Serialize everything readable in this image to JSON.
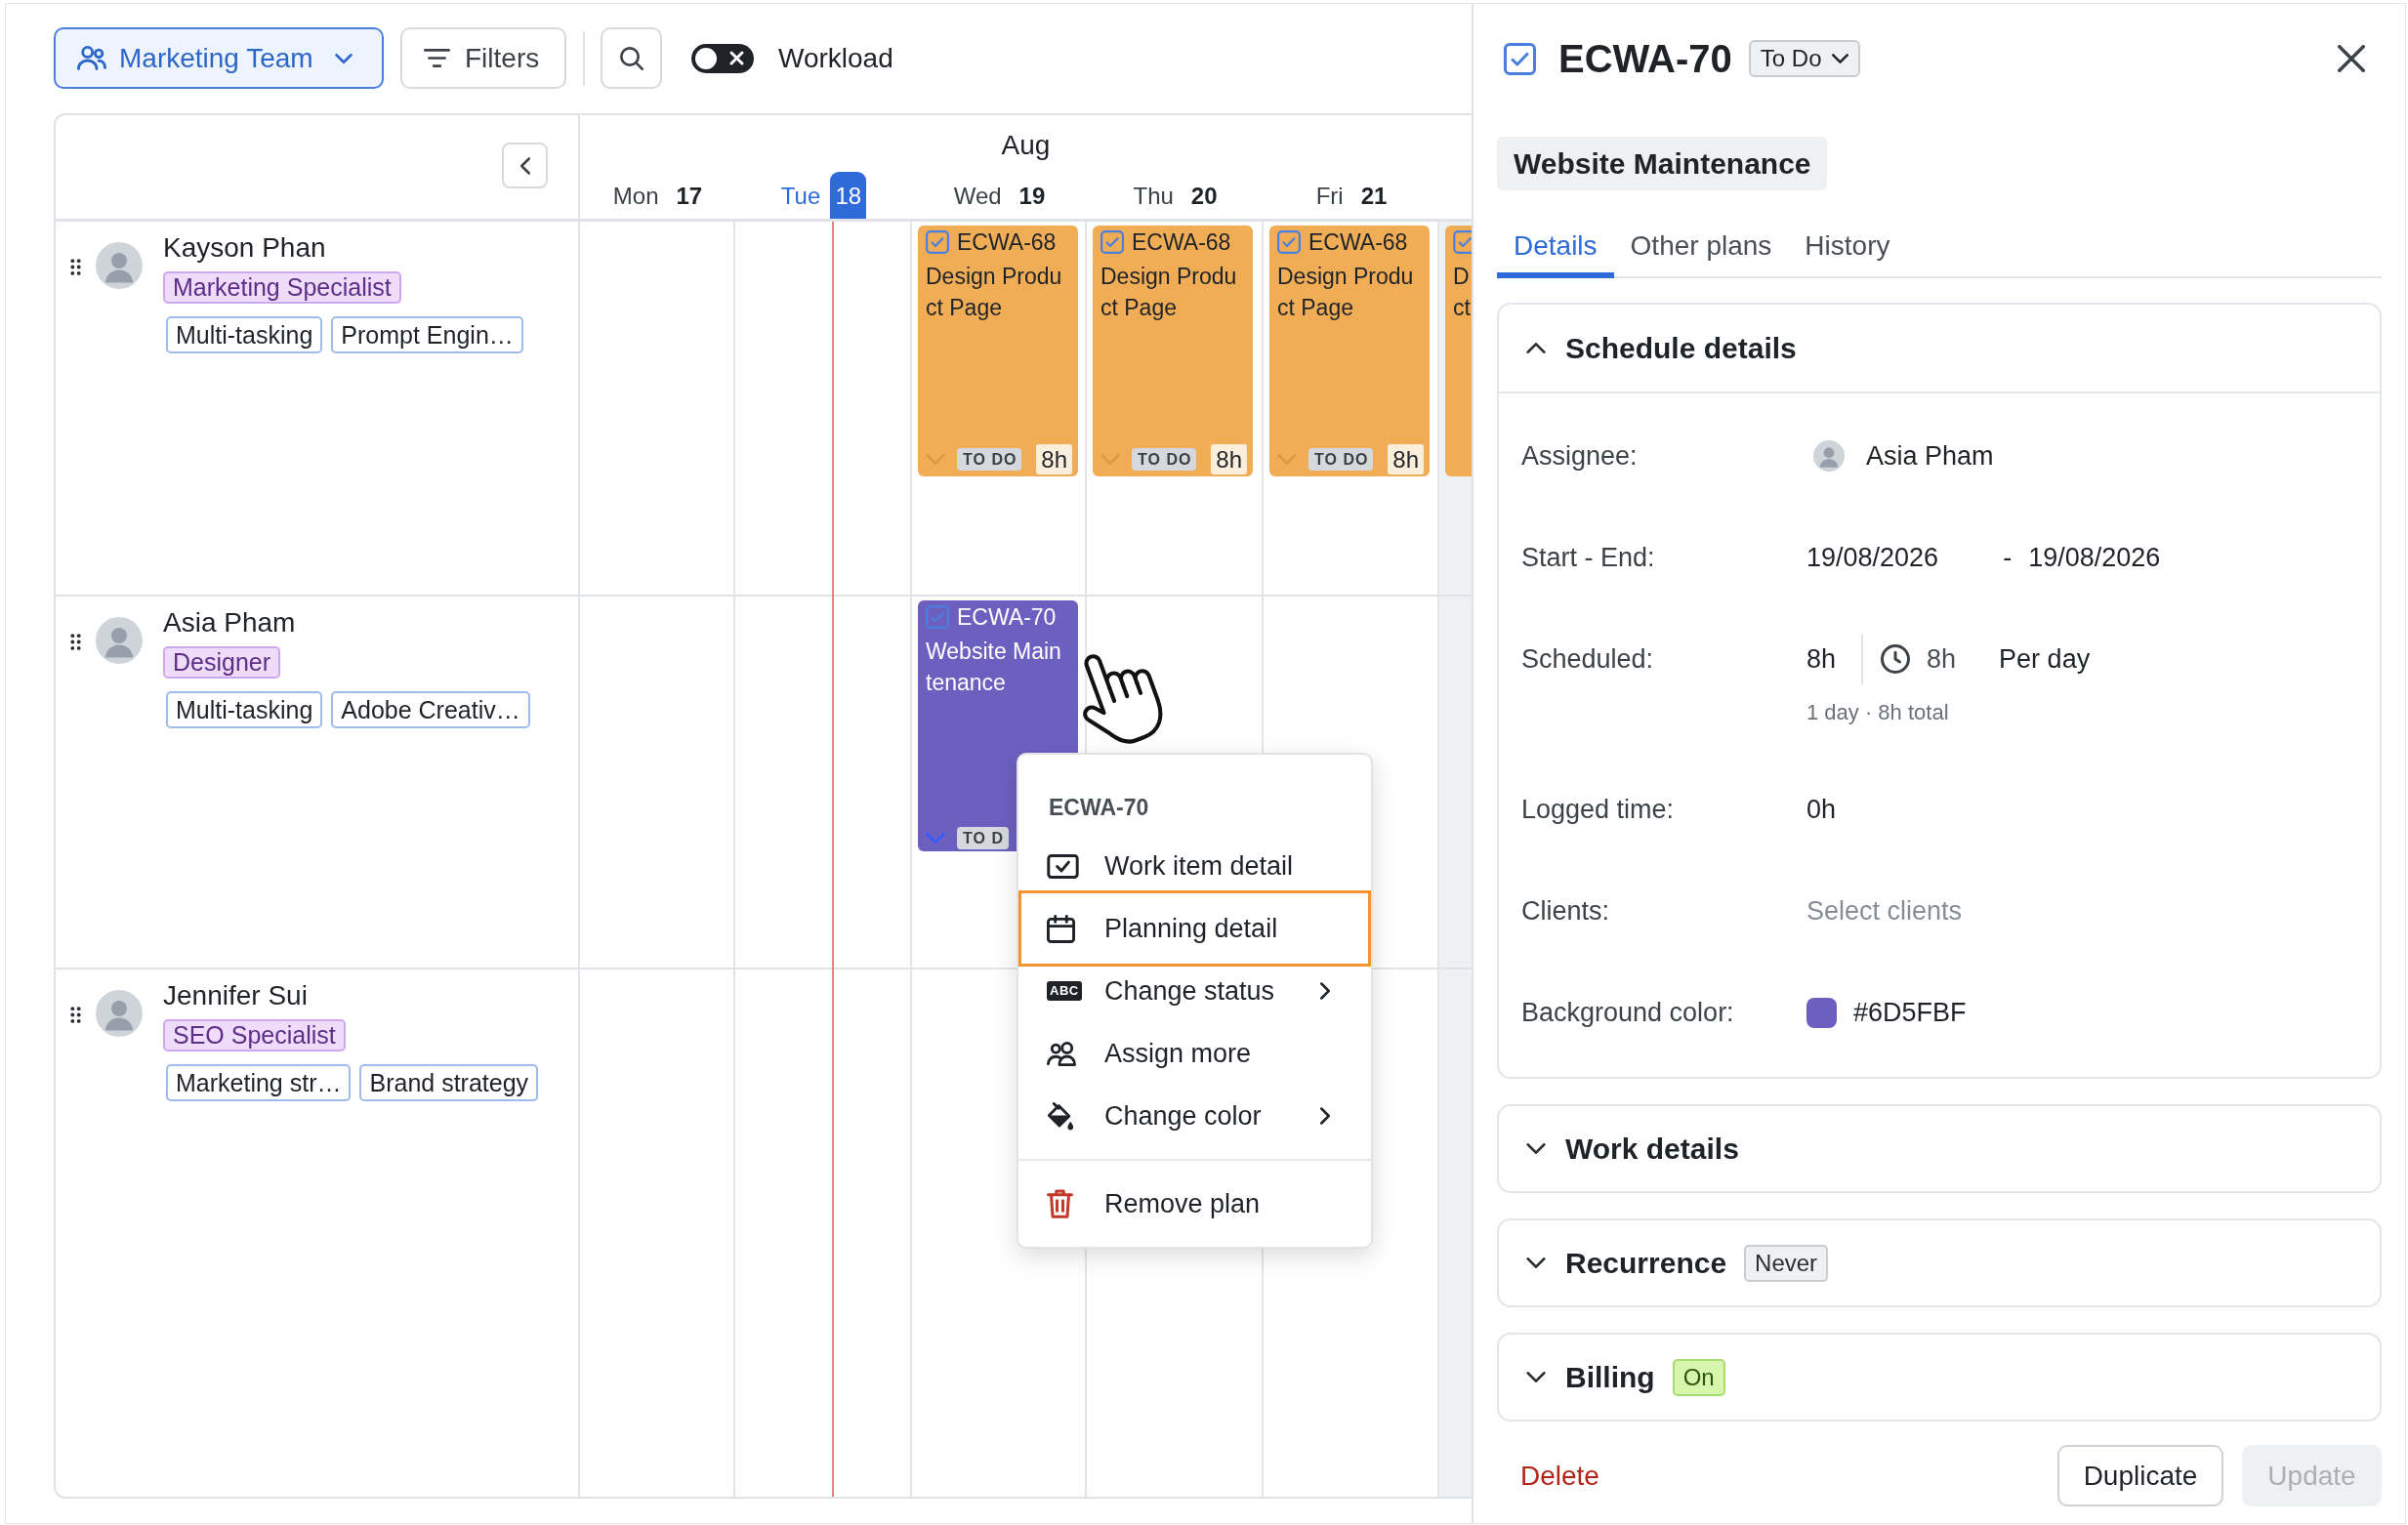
{
  "toolbar": {
    "team_button": {
      "label": "Marketing Team"
    },
    "filters_button": {
      "label": "Filters"
    },
    "workload_toggle": {
      "label": "Workload",
      "on": false
    }
  },
  "calendar": {
    "month": "Aug",
    "days": [
      {
        "name": "Mon",
        "number": "17",
        "today": false,
        "shaded": false
      },
      {
        "name": "Tue",
        "number": "18",
        "today": true,
        "shaded": false
      },
      {
        "name": "Wed",
        "number": "19",
        "today": false,
        "shaded": false
      },
      {
        "name": "Thu",
        "number": "20",
        "today": false,
        "shaded": false
      },
      {
        "name": "Fri",
        "number": "21",
        "today": false,
        "shaded": false
      },
      {
        "today": false,
        "shaded": true
      }
    ],
    "people": [
      {
        "name": "Kayson Phan",
        "role": "Marketing Specialist",
        "skills": [
          "Multi-tasking",
          "Prompt Engin…"
        ],
        "cells": [
          null,
          null,
          {
            "kind": "full",
            "key": "ECWA-68",
            "title": "Design Product Page",
            "status": "TO DO",
            "hours": "8h",
            "color": "#f0ad56",
            "selected": false
          },
          {
            "kind": "full",
            "key": "ECWA-68",
            "title": "Design Product Page",
            "status": "TO DO",
            "hours": "8h",
            "color": "#f0ad56",
            "selected": false
          },
          {
            "kind": "full",
            "key": "ECWA-68",
            "title": "Design Product Page",
            "status": "TO DO",
            "hours": "8h",
            "color": "#f0ad56",
            "selected": false
          },
          {
            "kind": "clipped",
            "lines": [
              "D",
              "ct"
            ],
            "color": "#f0ad56"
          }
        ]
      },
      {
        "name": "Asia Pham",
        "role": "Designer",
        "skills": [
          "Multi-tasking",
          "Adobe Creativ…"
        ],
        "cells": [
          null,
          null,
          {
            "kind": "full",
            "key": "ECWA-70",
            "title": "Website Maintenance",
            "status": "TO D",
            "color": "#6d5fbf",
            "selected": true
          },
          null,
          null,
          null
        ]
      },
      {
        "name": "Jennifer Sui",
        "role": "SEO Specialist",
        "skills": [
          "Marketing str…",
          "Brand strategy"
        ]
      }
    ]
  },
  "context_menu": {
    "title": "ECWA-70",
    "groups": [
      {
        "items": [
          {
            "label": "Work item detail",
            "kind": "detail",
            "submenu": false,
            "highlighted": false,
            "danger": false
          },
          {
            "label": "Planning detail",
            "kind": "planning",
            "submenu": false,
            "highlighted": true,
            "danger": false
          },
          {
            "label": "Change status",
            "kind": "status",
            "icon_text": "ABC",
            "submenu": true,
            "highlighted": false,
            "danger": false
          },
          {
            "label": "Assign more",
            "kind": "assign",
            "submenu": false,
            "highlighted": false,
            "danger": false
          },
          {
            "label": "Change color",
            "kind": "recolor",
            "submenu": true,
            "highlighted": false,
            "danger": false
          }
        ]
      },
      {
        "items": [
          {
            "label": "Remove plan",
            "kind": "remove",
            "submenu": false,
            "highlighted": false,
            "danger": true
          }
        ]
      }
    ]
  },
  "detail_panel": {
    "key": "ECWA-70",
    "status": "To Do",
    "title": "Website Maintenance",
    "tabs": [
      {
        "label": "Details",
        "selected": true
      },
      {
        "label": "Other plans",
        "selected": false
      },
      {
        "label": "History",
        "selected": false
      }
    ],
    "sections": [
      {
        "title": "Schedule details",
        "expanded": true,
        "fields": [
          {
            "kind": "person",
            "label": "Assignee:",
            "value": "Asia Pham"
          },
          {
            "kind": "range",
            "label": "Start - End:",
            "start": "19/08/2026",
            "separator": "-",
            "end": "19/08/2026"
          },
          {
            "kind": "scheduled",
            "label": "Scheduled:",
            "total": "8h",
            "daily": "8h",
            "unit": "Per day",
            "note": "1 day · 8h total"
          },
          {
            "kind": "text",
            "label": "Logged time:",
            "value": "0h"
          },
          {
            "kind": "select",
            "label": "Clients:",
            "placeholder": "Select clients"
          },
          {
            "kind": "color",
            "label": "Background color:",
            "color": "#6d5fbf",
            "value": "#6D5FBF"
          }
        ]
      },
      {
        "title": "Work details",
        "expanded": false
      },
      {
        "title": "Recurrence",
        "expanded": false,
        "badge": {
          "label": "Never",
          "kind": "neutral"
        }
      },
      {
        "title": "Billing",
        "expanded": false,
        "badge": {
          "label": "On",
          "kind": "success"
        }
      }
    ],
    "actions": [
      {
        "label": "Delete",
        "kind": "danger",
        "disabled": false
      },
      {
        "label": "Duplicate",
        "kind": "secondary",
        "disabled": false
      },
      {
        "label": "Update",
        "kind": "primary",
        "disabled": true
      }
    ]
  }
}
